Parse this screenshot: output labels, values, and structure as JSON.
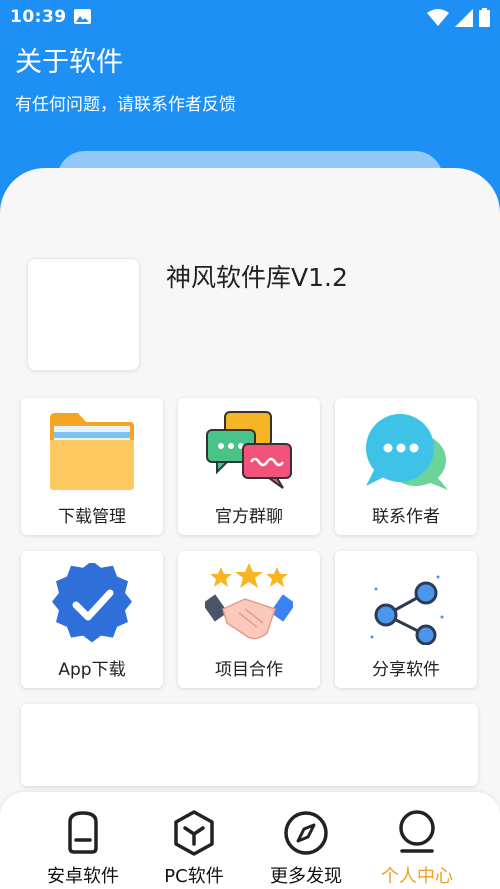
{
  "status": {
    "time": "10:39"
  },
  "header": {
    "title": "关于软件",
    "subtitle": "有任何问题，请联系作者反馈"
  },
  "app": {
    "name": "神风软件库V1.2"
  },
  "grid": [
    {
      "label": "下载管理",
      "icon": "folder-icon"
    },
    {
      "label": "官方群聊",
      "icon": "chat-group-icon"
    },
    {
      "label": "联系作者",
      "icon": "message-bubble-icon"
    },
    {
      "label": "App下载",
      "icon": "verified-badge-icon"
    },
    {
      "label": "项目合作",
      "icon": "handshake-icon"
    },
    {
      "label": "分享软件",
      "icon": "share-icon"
    }
  ],
  "nav": [
    {
      "label": "安卓软件",
      "icon": "android-home-icon"
    },
    {
      "label": "PC软件",
      "icon": "pc-cube-icon"
    },
    {
      "label": "更多发现",
      "icon": "compass-icon"
    },
    {
      "label": "个人中心",
      "icon": "user-icon",
      "active": true
    }
  ],
  "colors": {
    "primary": "#1e90f5",
    "accent": "#f0a020"
  }
}
